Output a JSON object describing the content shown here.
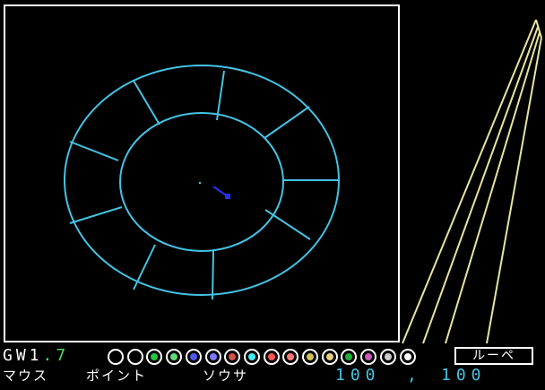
{
  "app": {
    "version_label": "GW1.7",
    "version_prefix": "GW1",
    "version_suffix": ".7"
  },
  "status": {
    "input_device": "マウス",
    "tool": "ポイント",
    "action": "ソウサ",
    "coord_x": "100",
    "coord_separator": ",",
    "coord_y": "100"
  },
  "toolbar": {
    "loupe_label": "ルーペ"
  },
  "palette": [
    {
      "name": "color-0-transparent",
      "fill": "#000000"
    },
    {
      "name": "color-1-black",
      "fill": "#000000"
    },
    {
      "name": "color-2-green",
      "fill": "#21c842"
    },
    {
      "name": "color-3-light-green",
      "fill": "#5edc78"
    },
    {
      "name": "color-4-dark-blue",
      "fill": "#5455ed"
    },
    {
      "name": "color-5-light-blue",
      "fill": "#7d76fc"
    },
    {
      "name": "color-6-dark-red",
      "fill": "#d4524d"
    },
    {
      "name": "color-7-cyan",
      "fill": "#42ebf5"
    },
    {
      "name": "color-8-red",
      "fill": "#fc5554"
    },
    {
      "name": "color-9-light-red",
      "fill": "#ff7978"
    },
    {
      "name": "color-10-dark-yellow",
      "fill": "#d4c154"
    },
    {
      "name": "color-11-light-yellow",
      "fill": "#e6ce80"
    },
    {
      "name": "color-12-dark-green",
      "fill": "#21b03b"
    },
    {
      "name": "color-13-magenta",
      "fill": "#c95bba"
    },
    {
      "name": "color-14-gray",
      "fill": "#cccccc"
    },
    {
      "name": "color-15-white",
      "fill": "#ffffff"
    }
  ],
  "colors": {
    "drawing": "#44c4e4",
    "cursor": "#2233ee",
    "loupe_rays": "#e8e4a0",
    "version_white": "#ffffff",
    "version_green": "#58d858",
    "coordinates": "#44c4e4",
    "border": "#ffffff"
  }
}
